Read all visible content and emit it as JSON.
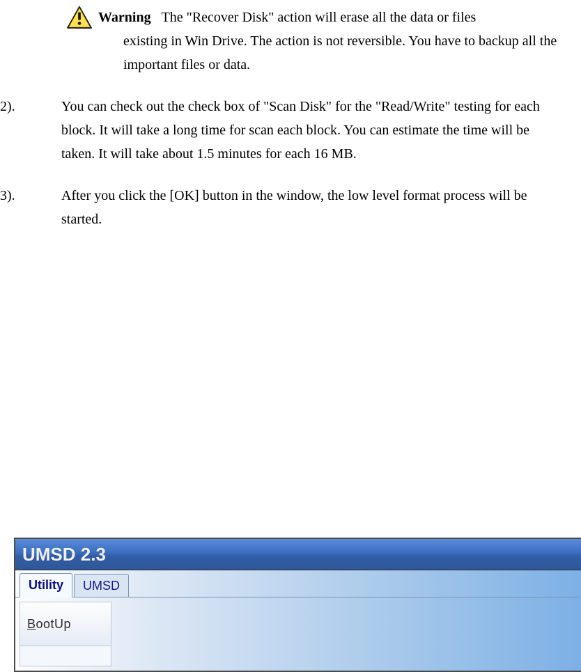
{
  "warning": {
    "label": "Warning",
    "text_first_line": "The  \"Recover Disk\" action will erase all the data or files",
    "text_rest": "existing in Win Drive. The action is not reversible. You have to backup all the important files or data."
  },
  "items": [
    {
      "num": "2).",
      "body": "You can check out the check box of \"Scan Disk\" for the \"Read/Write\" testing for each block. It will take a long time for scan each block. You can estimate the time will be taken. It will take about 1.5 minutes for each 16 MB."
    },
    {
      "num": "3).",
      "body": "After you click the [OK] button in the window, the low level format process will be started."
    }
  ],
  "app": {
    "title": "UMSD 2.3",
    "tabs": {
      "utility": "Utility",
      "umsd": "UMSD"
    },
    "sidebar": {
      "bootup_prefix": "B",
      "bootup_rest": "ootUp"
    }
  }
}
